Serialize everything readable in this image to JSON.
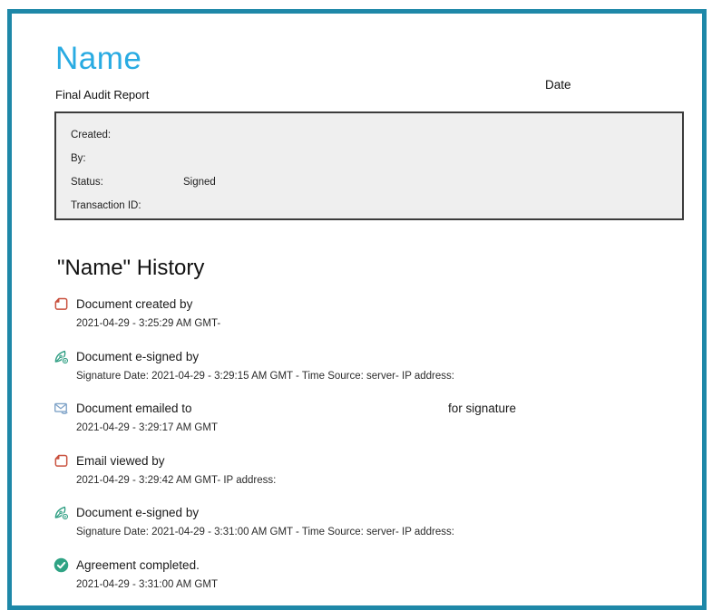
{
  "page": {
    "title": "Name",
    "subtitle": "Final Audit Report",
    "date_label": "Date"
  },
  "summary": {
    "created_label": "Created:",
    "created_value": "",
    "by_label": "By:",
    "by_value": "",
    "status_label": "Status:",
    "status_value": "Signed",
    "transaction_label": "Transaction ID:",
    "transaction_value": ""
  },
  "history": {
    "heading": "\"Name\" History",
    "events": [
      {
        "icon": "document-created-icon",
        "title": "Document created by",
        "title_suffix": "",
        "detail": "2021-04-29 - 3:25:29 AM GMT-"
      },
      {
        "icon": "esign-icon",
        "title": "Document e-signed by",
        "title_suffix": "",
        "detail": "Signature Date: 2021-04-29 - 3:29:15 AM GMT - Time Source: server- IP address:"
      },
      {
        "icon": "email-sent-icon",
        "title": "Document emailed to",
        "title_suffix": "for signature",
        "detail": "2021-04-29 - 3:29:17 AM GMT"
      },
      {
        "icon": "email-viewed-icon",
        "title": "Email viewed by",
        "title_suffix": "",
        "detail": "2021-04-29 - 3:29:42 AM GMT- IP address:"
      },
      {
        "icon": "esign-icon",
        "title": "Document e-signed by",
        "title_suffix": "",
        "detail": "Signature Date: 2021-04-29 - 3:31:00 AM GMT - Time Source: server- IP address:"
      },
      {
        "icon": "completed-icon",
        "title": "Agreement completed.",
        "title_suffix": "",
        "detail": "2021-04-29 - 3:31:00 AM GMT"
      }
    ]
  },
  "colors": {
    "frame_border": "#1e88a8",
    "title_blue": "#29abe2",
    "summary_bg": "#efefef",
    "summary_border": "#3c3c3c",
    "icon_red": "#c9513e",
    "icon_green": "#2e9e82",
    "icon_blue": "#7fa3c8"
  }
}
